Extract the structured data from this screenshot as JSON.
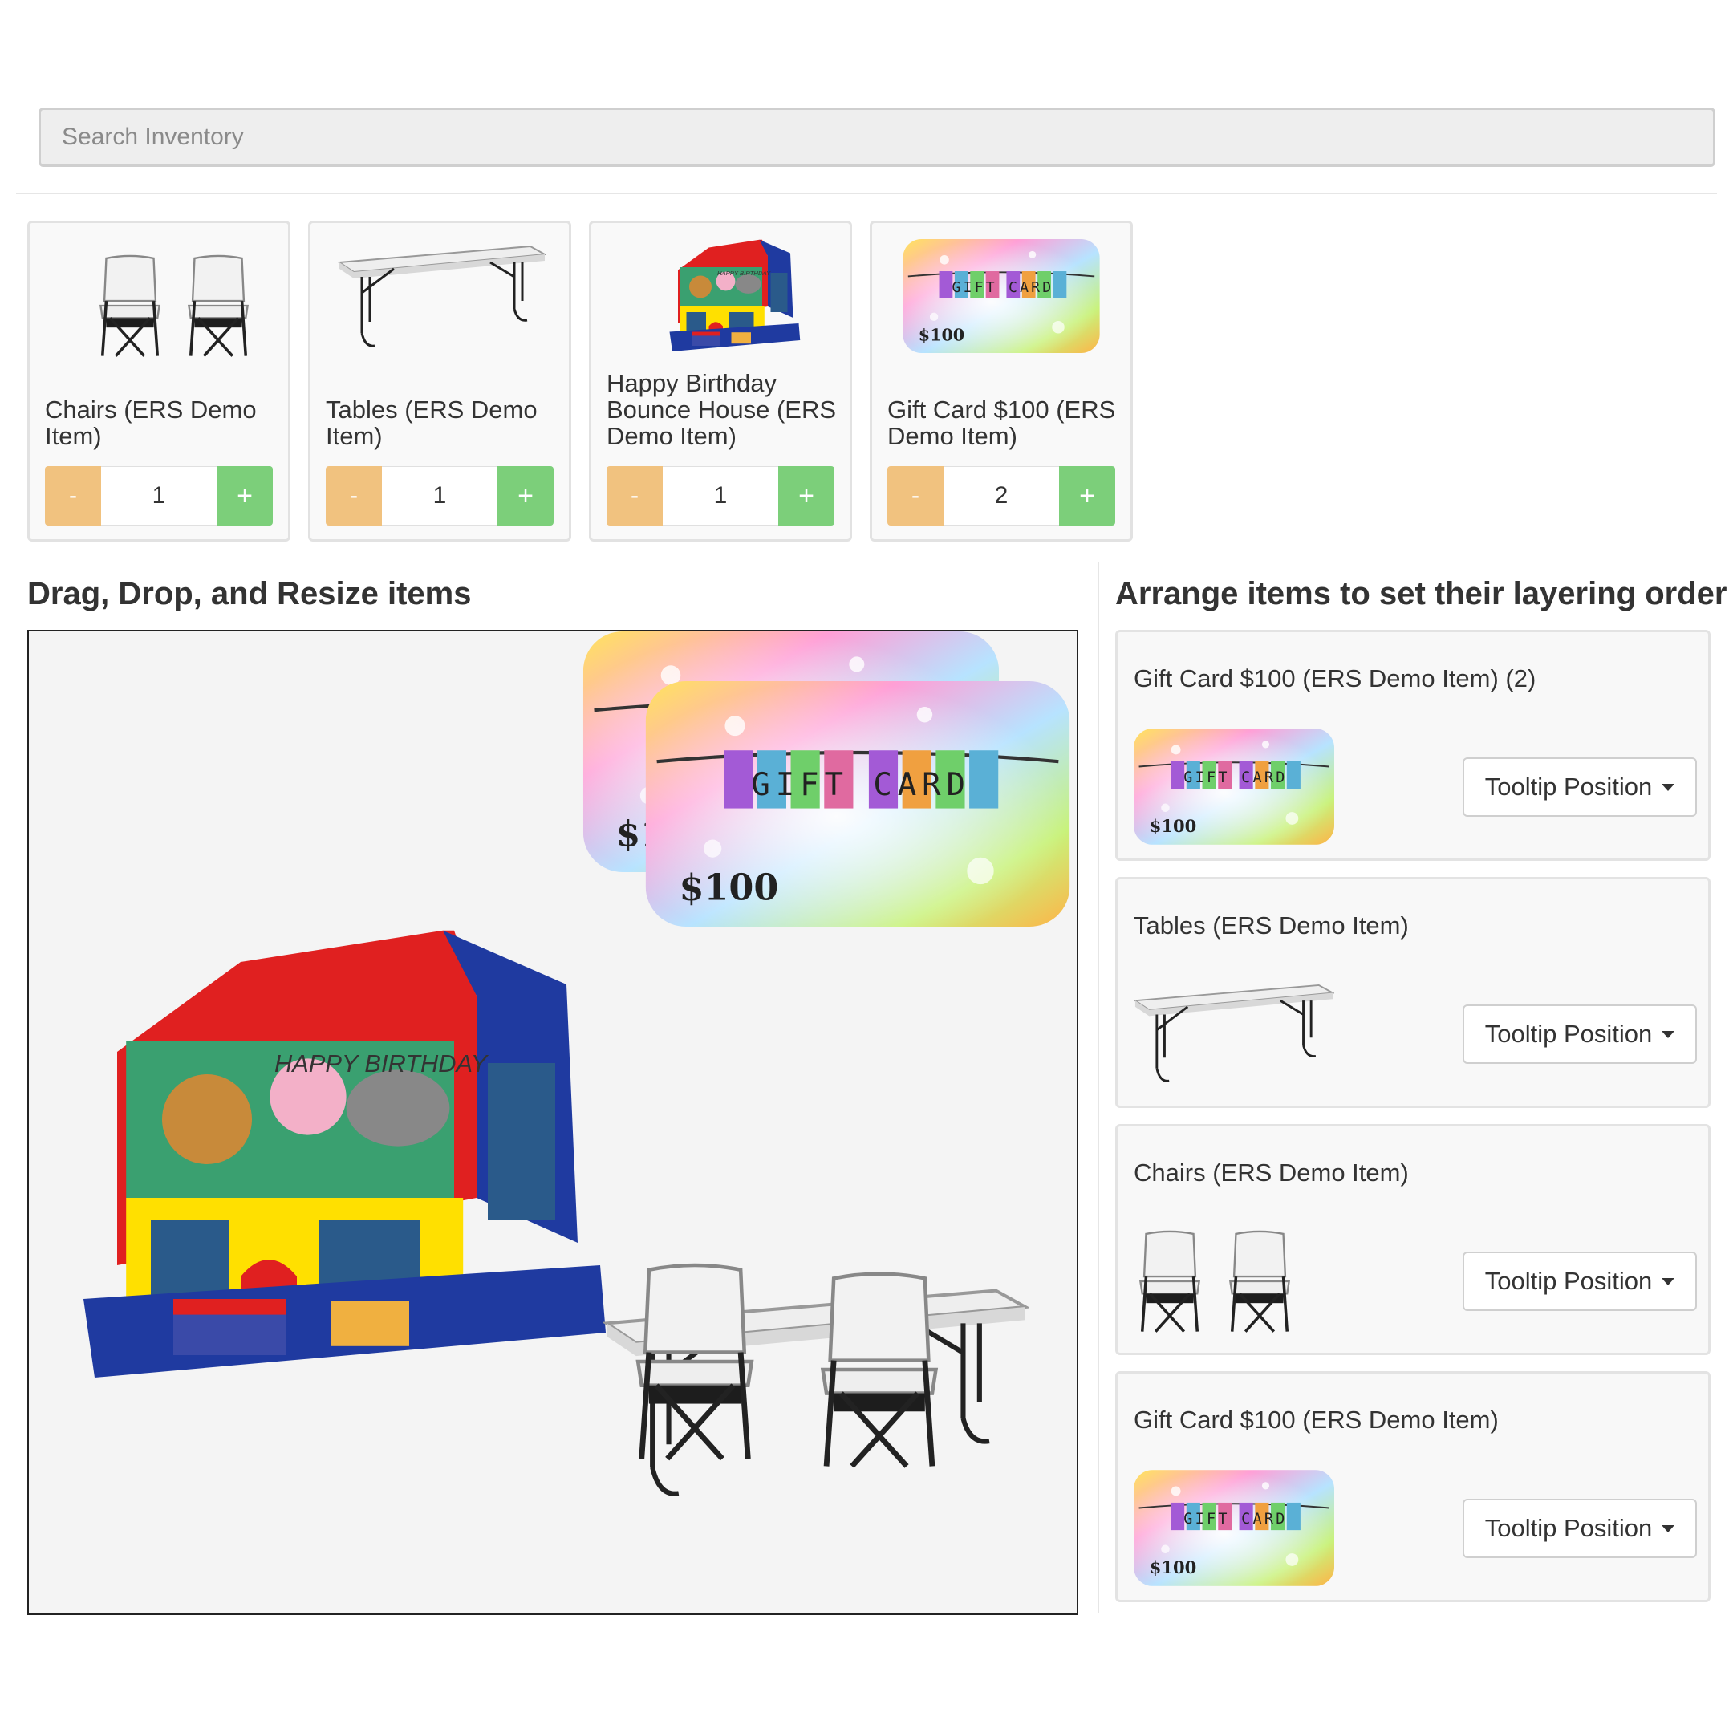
{
  "search": {
    "placeholder": "Search Inventory"
  },
  "inventory": {
    "minus_label": "-",
    "plus_label": "+",
    "items": [
      {
        "name": "Chairs (ERS Demo Item)",
        "qty": "1",
        "image": "chairs-image"
      },
      {
        "name": "Tables (ERS Demo Item)",
        "qty": "1",
        "image": "table-image"
      },
      {
        "name": "Happy Birthday Bounce House (ERS Demo Item)",
        "qty": "1",
        "image": "bounce-house-image"
      },
      {
        "name": "Gift Card $100 (ERS Demo Item)",
        "qty": "2",
        "image": "gift-card-image"
      }
    ]
  },
  "canvas": {
    "heading": "Drag, Drop, and Resize items"
  },
  "layers": {
    "heading": "Arrange items to set their layering order",
    "tooltip_label": "Tooltip Position",
    "items": [
      {
        "name": "Gift Card $100 (ERS Demo Item) (2)",
        "image": "gift-card-image"
      },
      {
        "name": "Tables (ERS Demo Item)",
        "image": "table-image"
      },
      {
        "name": "Chairs (ERS Demo Item)",
        "image": "chairs-image"
      },
      {
        "name": "Gift Card $100 (ERS Demo Item)",
        "image": "gift-card-image"
      }
    ]
  },
  "gift_card": {
    "banner_text": "GIFT CARD",
    "amount": "$100",
    "amount_partial": "$10"
  },
  "bounce_house": {
    "banner_text": "HAPPY BIRTHDAY"
  },
  "colors": {
    "minus": "#f1c27f",
    "plus": "#7ccf7a"
  }
}
